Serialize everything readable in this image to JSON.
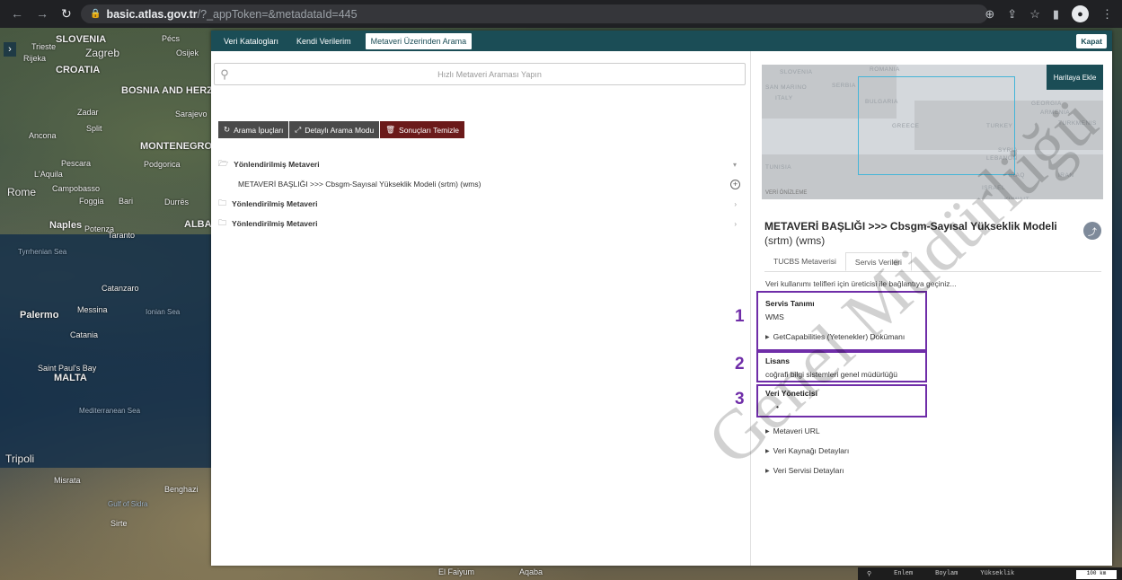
{
  "browser": {
    "url_host": "basic.atlas.gov.tr",
    "url_path": "/?_appToken=&metadataId=445"
  },
  "map_labels": [
    {
      "text": "SLOVENIA"
    },
    {
      "text": "Trieste"
    },
    {
      "text": "Zagreb"
    },
    {
      "text": "Rijeka"
    },
    {
      "text": "CROATIA"
    },
    {
      "text": "Pécs"
    },
    {
      "text": "Osijek"
    },
    {
      "text": "BOSNIA AND HERZEGOVINA"
    },
    {
      "text": "Zadar"
    },
    {
      "text": "Sarajevo"
    },
    {
      "text": "Split"
    },
    {
      "text": "MONTENEGRO"
    },
    {
      "text": "Podgorica"
    },
    {
      "text": "Ancona"
    },
    {
      "text": "Pescara"
    },
    {
      "text": "L'Aquila"
    },
    {
      "text": "Rome"
    },
    {
      "text": "Campobasso"
    },
    {
      "text": "Foggia"
    },
    {
      "text": "Bari"
    },
    {
      "text": "Durrës"
    },
    {
      "text": "Naples"
    },
    {
      "text": "Potenza"
    },
    {
      "text": "Taranto"
    },
    {
      "text": "ALBANIA"
    },
    {
      "text": "Tyrrhenian Sea"
    },
    {
      "text": "Catanzaro"
    },
    {
      "text": "Palermo"
    },
    {
      "text": "Messina"
    },
    {
      "text": "Ionian Sea"
    },
    {
      "text": "Catania"
    },
    {
      "text": "Saint Paul's Bay"
    },
    {
      "text": "MALTA"
    },
    {
      "text": "Mediterranean Sea"
    },
    {
      "text": "Tripoli"
    },
    {
      "text": "Misrata"
    },
    {
      "text": "Benghazi"
    },
    {
      "text": "Gulf of Sidra"
    },
    {
      "text": "Sirte"
    },
    {
      "text": "El Faiyum"
    },
    {
      "text": "Aqaba"
    }
  ],
  "topbar": {
    "tabs": [
      "Veri Katalogları",
      "Kendi Verilerim",
      "Metaveri Üzerinden Arama"
    ],
    "close_label": "Kapat"
  },
  "search": {
    "placeholder": "Hızlı Metaveri Araması Yapın"
  },
  "buttons": {
    "tips": "Arama İpuçları",
    "detail": "Detaylı Arama Modu",
    "clear": "Sonuçları Temizle"
  },
  "tree": {
    "item1": "Yönlendirilmiş Metaveri",
    "child1": "METAVERİ BAŞLIĞI >>> Cbsgm-Sayısal Yükseklik Modeli (srtm) (wms)",
    "item2": "Yönlendirilmiş Metaveri",
    "item3": "Yönlendirilmiş Metaveri"
  },
  "preview": {
    "add_to_map": "Haritaya Ekle",
    "label": "VERİ ÖNİZLEME",
    "countries": [
      "SLOVENIA",
      "ROMANIA",
      "SAN MARINO",
      "SERBIA",
      "ITALY",
      "BULGARIA",
      "GEORGIA",
      "ARMENIA",
      "TURKMENIS",
      "TURKEY",
      "GREECE",
      "SYRIA",
      "LEBANON",
      "IRAQ",
      "IRAN",
      "ISRAEL",
      "KUWAIT",
      "TUNISIA"
    ]
  },
  "detail": {
    "title": "METAVERİ BAŞLIĞI >>> Cbsgm-Sayısal Yükseklik Modeli",
    "title2": "(srtm) (wms)",
    "tabs": [
      "TUCBS Metaverisi",
      "Servis Verileri"
    ],
    "notice": "Veri kullanımı telifleri için üreticisi ile bağlantıya geçiniz...",
    "service_heading": "Servis Tanımı",
    "service_value": "WMS",
    "getcap": "GetCapabilities (Yetenekler) Dokümanı",
    "license_heading": "Lisans",
    "license_value": "coğrafi bilgi sistemleri genel müdürlüğü",
    "admin_heading": "Veri Yöneticisi",
    "admin_value": "•",
    "links": [
      "Metaveri URL",
      "Veri Kaynağı Detayları",
      "Veri Servisi Detayları"
    ]
  },
  "callouts": [
    "1",
    "2",
    "3"
  ],
  "watermark": "Genel Müdürlüğü",
  "statusbar": {
    "lat": "Enlem",
    "lon": "Boylam",
    "elev": "Yükseklik",
    "scale": "100 km"
  },
  "colors": {
    "teal": "#1b4d56",
    "callout": "#6f2da8",
    "clear_btn": "#6b1a1a"
  }
}
